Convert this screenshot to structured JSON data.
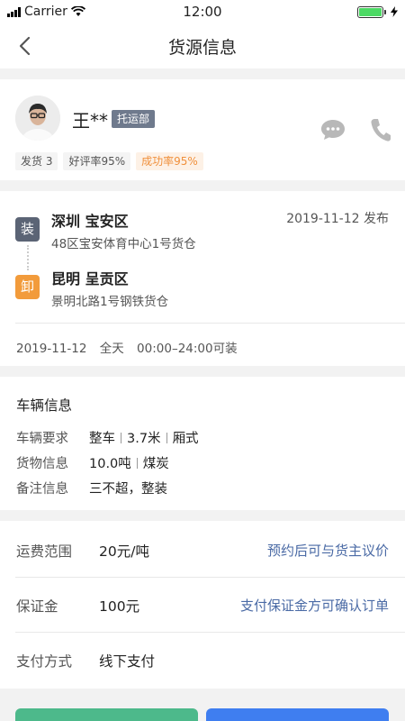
{
  "status_bar": {
    "carrier": "Carrier",
    "time": "12:00"
  },
  "nav": {
    "title": "货源信息"
  },
  "user": {
    "name": "王**",
    "role": "托运部",
    "stats": [
      "发货 3",
      "好评率95%",
      "成功率95%"
    ]
  },
  "route": {
    "from_city": "深圳  宝安区",
    "from_address": "48区宝安体育中心1号货仓",
    "to_city": "昆明  呈贡区",
    "to_address": "景明北路1号钢铁货仓",
    "load_badge": "装",
    "unload_badge": "卸",
    "publish": "2019-11-12 发布",
    "load_time": "2019-11-12 全天 00:00–24:00可装"
  },
  "vehicle": {
    "title": "车辆信息",
    "req_label": "车辆要求",
    "req_values": [
      "整车",
      "3.7米",
      "厢式"
    ],
    "cargo_label": "货物信息",
    "cargo_values": [
      "10.0吨",
      "煤炭"
    ],
    "note_label": "备注信息",
    "note_value": "三不超，整装"
  },
  "payment": {
    "fee_label": "运费范围",
    "fee_value": "20元/吨",
    "fee_link": "预约后可与货主议价",
    "deposit_label": "保证金",
    "deposit_value": "100元",
    "deposit_link": "支付保证金方可确认订单",
    "method_label": "支付方式",
    "method_value": "线下支付"
  },
  "colors": {
    "accent_blue": "#3f7ef0",
    "accent_green": "#4db98b",
    "orange": "#f29b3b",
    "link": "#4a6aa5"
  }
}
